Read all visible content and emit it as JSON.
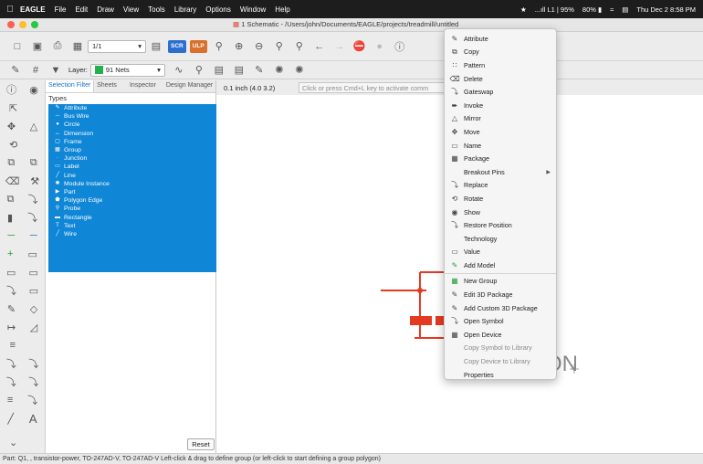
{
  "menubar": {
    "app": "EAGLE",
    "menus": [
      "File",
      "Edit",
      "Draw",
      "View",
      "Tools",
      "Library",
      "Options",
      "Window",
      "Help"
    ],
    "status": {
      "signal": "...ıll L1 | 95%",
      "battery": "80%",
      "clock": "Thu Dec 2  8:58 PM"
    }
  },
  "window": {
    "title": "1 Schematic - /Users/john/Documents/EAGLE/projects/treadmill/untitled"
  },
  "toolbar1": {
    "sheet_select": "1/1",
    "scr_label": "SCR",
    "ulp_label": "ULP"
  },
  "toolbar2": {
    "layer_label": "Layer:",
    "layer_value": "91 Nets",
    "layer_color": "#22b14c"
  },
  "panel": {
    "tabs": [
      "Selection Filter",
      "Sheets",
      "Inspector",
      "Design Manager"
    ],
    "types_header": "Types",
    "types": [
      {
        "label": "Attribute",
        "icon": "attribute-icon"
      },
      {
        "label": "Bus Wire",
        "icon": "bus-icon"
      },
      {
        "label": "Circle",
        "icon": "circle-icon"
      },
      {
        "label": "Dimension",
        "icon": "dimension-icon"
      },
      {
        "label": "Frame",
        "icon": "frame-icon"
      },
      {
        "label": "Group",
        "icon": "group-icon"
      },
      {
        "label": "Junction",
        "icon": "junction-icon"
      },
      {
        "label": "Label",
        "icon": "label-icon"
      },
      {
        "label": "Line",
        "icon": "line-icon"
      },
      {
        "label": "Module Instance",
        "icon": "module-icon"
      },
      {
        "label": "Part",
        "icon": "part-icon"
      },
      {
        "label": "Polygon Edge",
        "icon": "polygon-icon"
      },
      {
        "label": "Probe",
        "icon": "probe-icon"
      },
      {
        "label": "Rectangle",
        "icon": "rectangle-icon"
      },
      {
        "label": "Text",
        "icon": "text-icon"
      },
      {
        "label": "Wire",
        "icon": "wire-icon"
      }
    ],
    "reset_label": "Reset"
  },
  "command": {
    "coordinate": "0.1 inch (4.0 3.2)",
    "placeholder": "Click or press Cmd+L key to activate comm"
  },
  "canvas": {
    "text_fragment": "ON"
  },
  "context_menu": {
    "items": [
      {
        "label": "Attribute",
        "icon": "attribute-icon",
        "disabled": false
      },
      {
        "label": "Copy",
        "icon": "copy-icon",
        "disabled": false
      },
      {
        "label": "Pattern",
        "icon": "pattern-icon",
        "disabled": false
      },
      {
        "label": "Delete",
        "icon": "trash-icon",
        "disabled": false
      },
      {
        "label": "Gateswap",
        "icon": "gateswap-icon",
        "disabled": false
      },
      {
        "label": "Invoke",
        "icon": "invoke-icon",
        "disabled": false
      },
      {
        "label": "Mirror",
        "icon": "mirror-icon",
        "disabled": false
      },
      {
        "label": "Move",
        "icon": "move-icon",
        "disabled": false
      },
      {
        "label": "Name",
        "icon": "name-icon",
        "disabled": false
      },
      {
        "label": "Package",
        "icon": "package-icon",
        "disabled": false
      },
      {
        "label": "Breakout Pins",
        "icon": "",
        "disabled": false,
        "submenu": true
      },
      {
        "label": "Replace",
        "icon": "replace-icon",
        "disabled": false
      },
      {
        "label": "Rotate",
        "icon": "rotate-icon",
        "disabled": false
      },
      {
        "label": "Show",
        "icon": "eye-icon",
        "disabled": false
      },
      {
        "label": "Restore Position",
        "icon": "restore-icon",
        "disabled": false
      },
      {
        "label": "Technology",
        "icon": "",
        "disabled": false
      },
      {
        "label": "Value",
        "icon": "value-icon",
        "disabled": false
      },
      {
        "label": "Add Model",
        "icon": "add-model-icon",
        "disabled": false
      },
      {
        "label": "New Group",
        "icon": "new-group-icon",
        "disabled": false
      },
      {
        "label": "Edit 3D Package",
        "icon": "edit-3d-icon",
        "disabled": false
      },
      {
        "label": "Add Custom 3D Package",
        "icon": "add-3d-icon",
        "disabled": false
      },
      {
        "label": "Open Symbol",
        "icon": "open-symbol-icon",
        "disabled": false
      },
      {
        "label": "Open Device",
        "icon": "open-device-icon",
        "disabled": false
      },
      {
        "label": "Copy Symbol to Library",
        "icon": "",
        "disabled": true
      },
      {
        "label": "Copy Device to Library",
        "icon": "",
        "disabled": true
      },
      {
        "label": "Properties",
        "icon": "",
        "disabled": false
      }
    ]
  },
  "statusbar": {
    "text": "Part: Q1, , transistor-power, TO-247AD-V, TO-247AD-V Left-click & drag to define group (or left-click to start defining a group polygon)"
  }
}
